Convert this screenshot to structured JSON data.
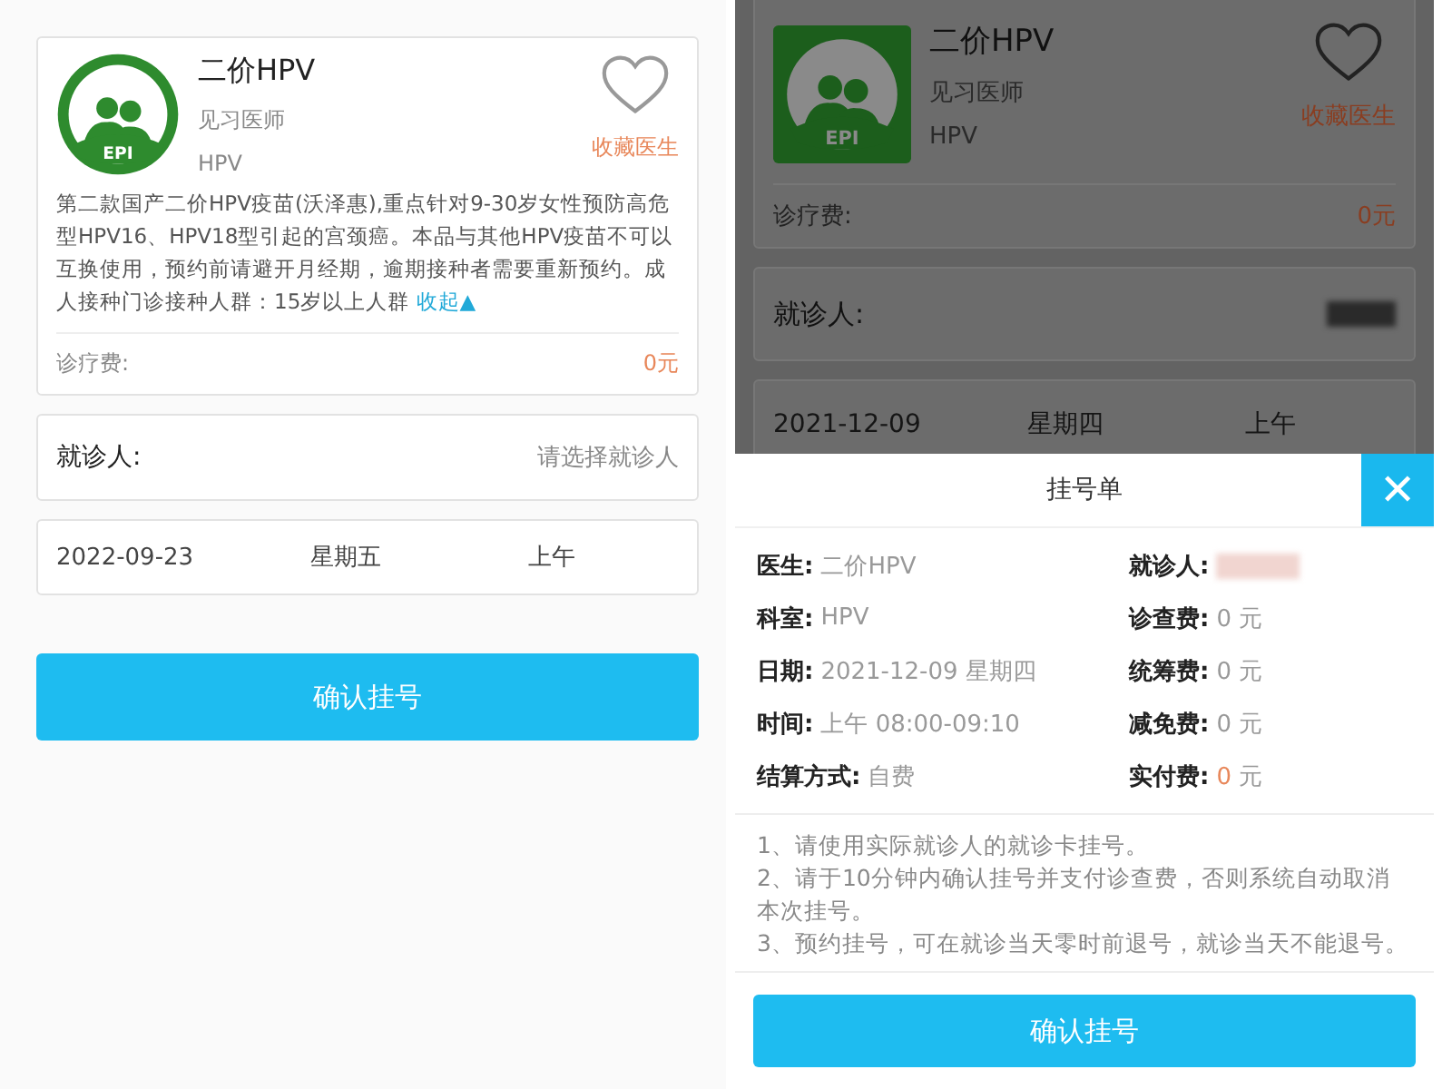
{
  "left": {
    "doctor": {
      "logo": {
        "kind": "circle",
        "badge": "EPI"
      },
      "name": "二价HPV",
      "title": "见习医师",
      "department": "HPV",
      "favorite": {
        "label": "收藏医生",
        "selected": false
      },
      "description": "第二款国产二价HPV疫苗(沃泽惠),重点针对9-30岁女性预防高危型HPV16、HPV18型引起的宫颈癌。本品与其他HPV疫苗不可以互换使用，预约前请避开月经期，逾期接种者需要重新预约。成人接种门诊接种人群：15岁以上人群",
      "collapse_link": "收起▲",
      "fee_label": "诊疗费:",
      "fee_value": "0元"
    },
    "patient": {
      "label": "就诊人:",
      "placeholder": "请选择就诊人"
    },
    "slot": {
      "date": "2022-09-23",
      "weekday": "星期五",
      "period": "上午"
    },
    "confirm_button": "确认挂号"
  },
  "right": {
    "doctor": {
      "logo": {
        "kind": "square",
        "badge": "EPI"
      },
      "name": "二价HPV",
      "title": "见习医师",
      "department": "HPV",
      "favorite": {
        "label": "收藏医生",
        "selected": false
      },
      "fee_label": "诊疗费:",
      "fee_value": "0元"
    },
    "patient": {
      "label": "就诊人:",
      "redacted": true
    },
    "slot": {
      "date": "2021-12-09",
      "weekday": "星期四",
      "period": "上午"
    },
    "modal": {
      "title": "挂号单",
      "close": "✕",
      "rows": [
        {
          "left": {
            "label": "医生:",
            "kind": "plain",
            "value": "二价HPV"
          },
          "right": {
            "label": "就诊人:",
            "kind": "redacted"
          }
        },
        {
          "left": {
            "label": "科室:",
            "kind": "plain",
            "value": "HPV"
          },
          "right": {
            "label": "诊查费:",
            "kind": "plain",
            "value": "0",
            "unit": "元"
          }
        },
        {
          "left": {
            "label": "日期:",
            "kind": "plain",
            "value": "2021-12-09 星期四"
          },
          "right": {
            "label": "统筹费:",
            "kind": "plain",
            "value": "0",
            "unit": "元"
          }
        },
        {
          "left": {
            "label": "时间:",
            "kind": "plain",
            "value": "上午 08:00-09:10"
          },
          "right": {
            "label": "减免费:",
            "kind": "plain",
            "value": "0",
            "unit": "元"
          }
        },
        {
          "left": {
            "label": "结算方式:",
            "kind": "plain",
            "value": "自费"
          },
          "right": {
            "label": "实付费:",
            "kind": "highlight",
            "value": "0",
            "unit": "元"
          }
        }
      ],
      "notes": [
        "1、请使用实际就诊人的就诊卡挂号。",
        "2、请于10分钟内确认挂号并支付诊查费，否则系统自动取消本次挂号。",
        "3、预约挂号，可在就诊当天零时前退号，就诊当天不能退号。"
      ],
      "confirm_button": "确认挂号"
    }
  }
}
